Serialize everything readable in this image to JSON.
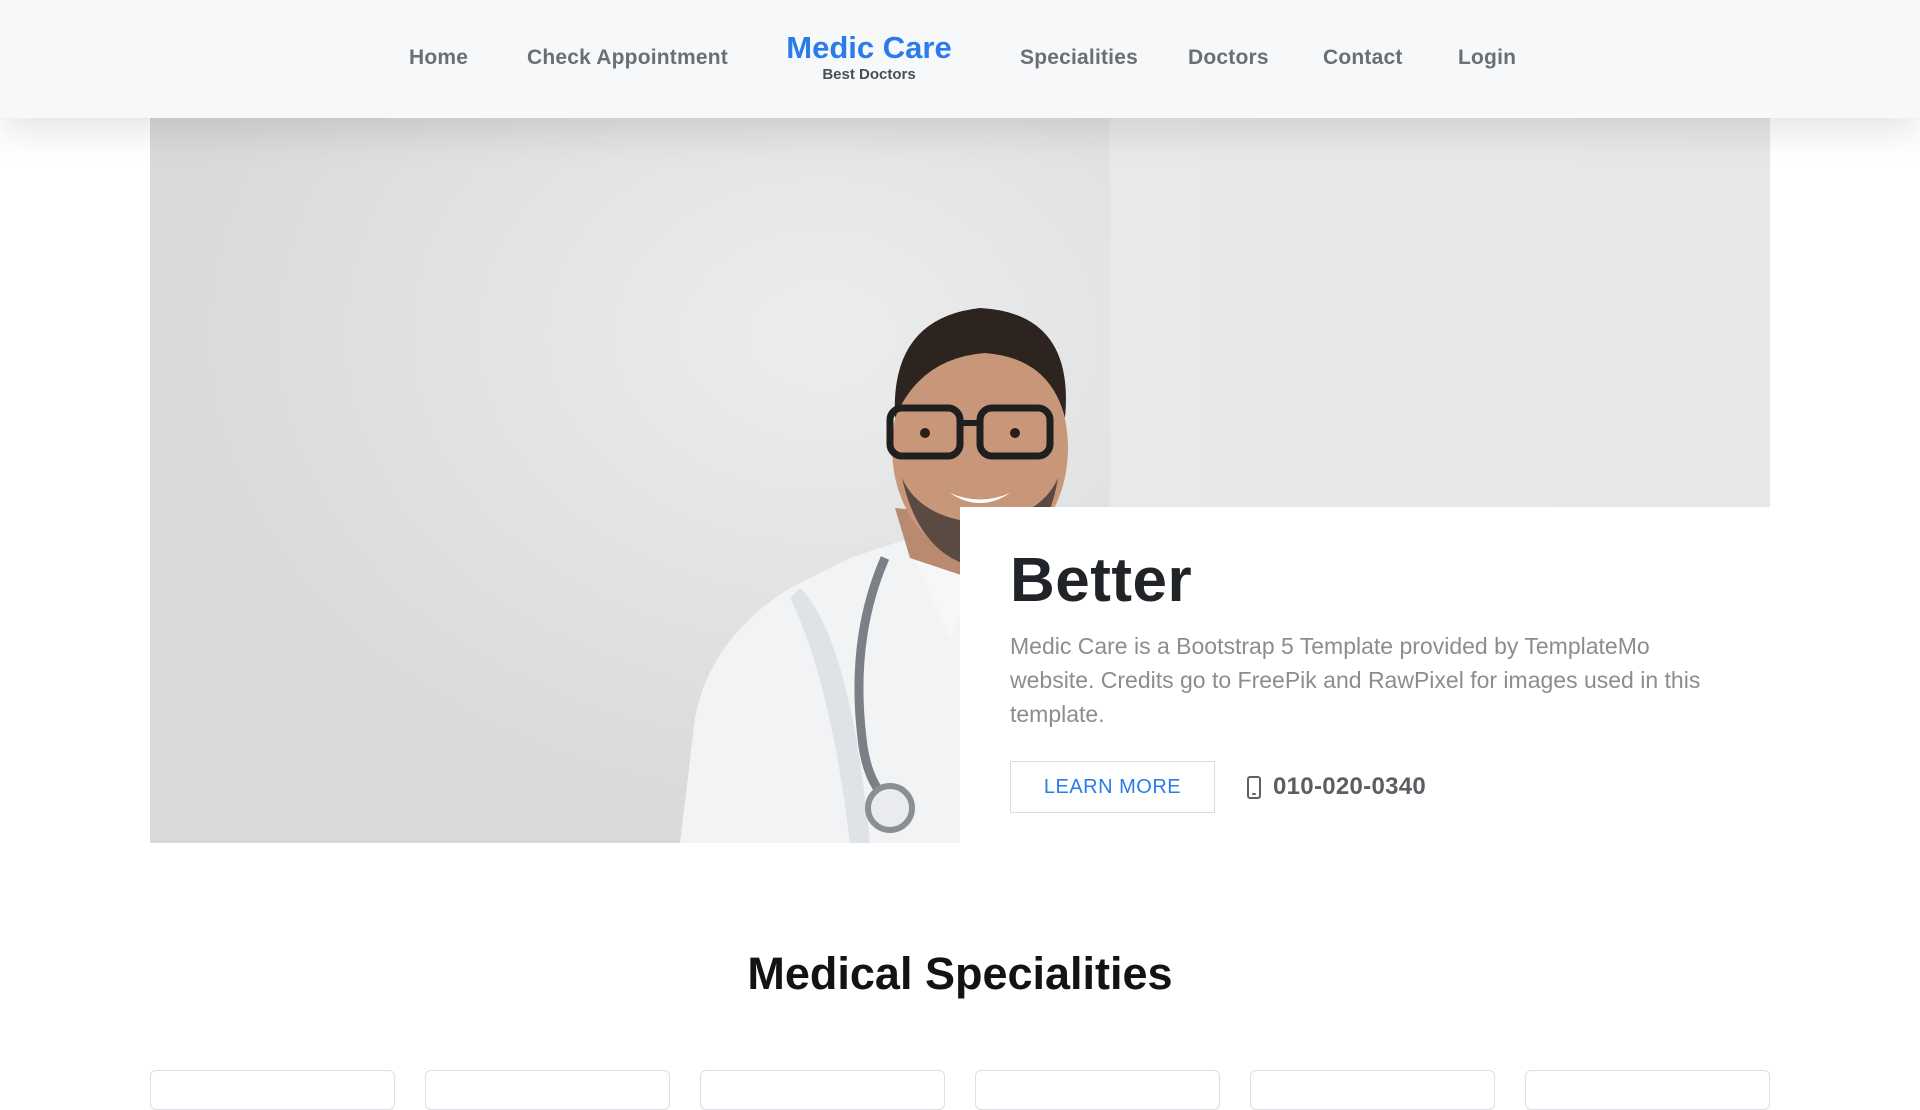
{
  "nav": {
    "items": [
      {
        "label": "Home"
      },
      {
        "label": "Check Appointment"
      },
      {
        "label": "Specialities"
      },
      {
        "label": "Doctors"
      },
      {
        "label": "Contact"
      },
      {
        "label": "Login"
      }
    ],
    "brand": {
      "title": "Medic Care",
      "subtitle": "Best Doctors"
    }
  },
  "hero": {
    "title": "Better",
    "description": "Medic Care is a Bootstrap 5 Template provided by TemplateMo website. Credits go to FreePik and RawPixel for images used in this template.",
    "button_label": "LEARN MORE",
    "phone": "010-020-0340",
    "phone_icon": "mobile-phone-icon"
  },
  "specialities": {
    "title": "Medical Specialities",
    "card_count": 6
  },
  "colors": {
    "accent": "#2a7bec",
    "nav_bg": "#f7f8fa",
    "text_dark": "#202428",
    "text_muted": "#8a8d91"
  }
}
